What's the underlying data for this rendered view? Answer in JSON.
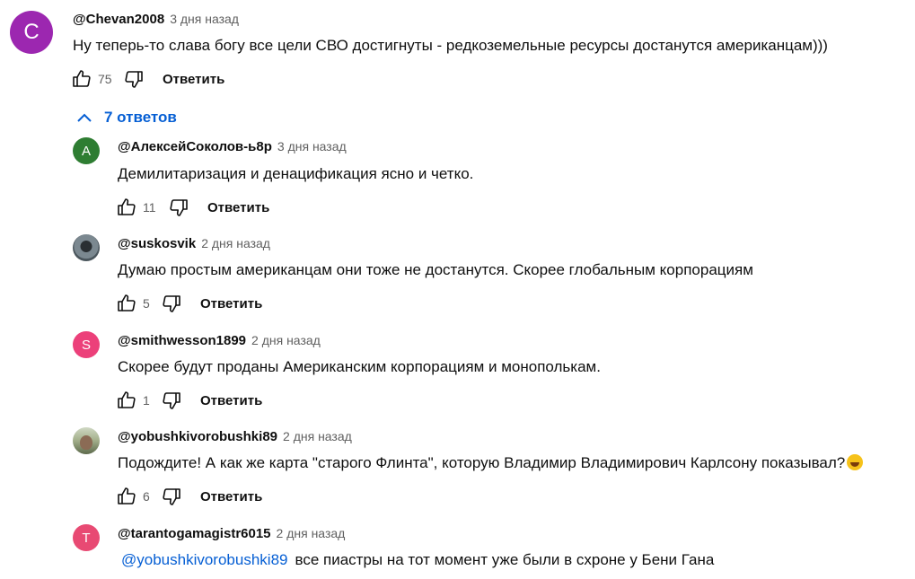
{
  "top_comment": {
    "avatar_letter": "C",
    "avatar_color": "#9c27b0",
    "author": "@Chevan2008",
    "time": "3 дня назад",
    "text": "Ну теперь-то слава богу все цели СВО достигнуты - редкоземельные ресурсы достанутся американцам)))",
    "likes": "75",
    "reply_label": "Ответить"
  },
  "replies_toggle": {
    "label": "7 ответов",
    "color": "#065fd4"
  },
  "replies": [
    {
      "avatar_letter": "A",
      "avatar_color": "#2e7d32",
      "author": "@АлексейСоколов-ь8р",
      "time": "3 дня назад",
      "text": "Демилитаризация и денацификация ясно и четко.",
      "likes": "11",
      "reply_label": "Ответить"
    },
    {
      "avatar_letter": "",
      "avatar_color": "#5b6770",
      "author": "@suskosvik",
      "time": "2 дня назад",
      "text": "Думаю простым американцам они тоже не достанутся. Скорее глобальным корпорациям",
      "likes": "5",
      "reply_label": "Ответить"
    },
    {
      "avatar_letter": "S",
      "avatar_color": "#ec407a",
      "author": "@smithwesson1899",
      "time": "2 дня назад",
      "text": "Скорее будут проданы Американским корпорациям и монополькам.",
      "likes": "1",
      "reply_label": "Ответить"
    },
    {
      "avatar_letter": "",
      "avatar_color": "#8d9a7a",
      "author": "@yobushkivorobushki89",
      "time": "2 дня назад",
      "text": "Подождите! А как же карта \"старого Флинта\", которую Владимир Владимирович Карлсону показывал?",
      "likes": "6",
      "reply_label": "Ответить"
    },
    {
      "avatar_letter": "T",
      "avatar_color": "#e84a73",
      "author": "@tarantogamagistr6015",
      "time": "2 дня назад",
      "mention": "@yobushkivorobushki89",
      "text": "все пиастры на тот момент уже были в схроне у Бени Гана",
      "likes": "",
      "reply_label": ""
    }
  ],
  "icons": {
    "like": "thumb-up-icon",
    "dislike": "thumb-down-icon",
    "collapse": "chevron-up-icon"
  }
}
